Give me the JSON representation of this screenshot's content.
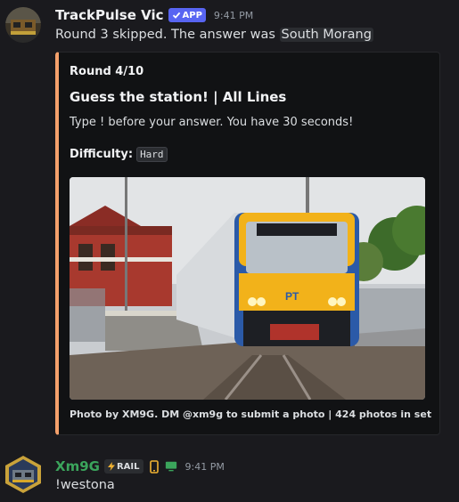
{
  "bot_message": {
    "username": "TrackPulse Vic",
    "badge": "APP",
    "time": "9:41 PM",
    "text_prefix": "Round 3 skipped. The answer was ",
    "answer": "South Morang"
  },
  "embed": {
    "accent_color": "#f4a06b",
    "round": "Round 4/10",
    "title": "Guess the station! | All Lines",
    "description": "Type ! before your answer. You have 30 seconds!",
    "difficulty_label": "Difficulty:",
    "difficulty_value": "Hard",
    "footer": "Photo by XM9G. DM @xm9g to submit a photo | 424 photos in set"
  },
  "user_message": {
    "username": "Xm9G",
    "badge": "RAIL",
    "time": "9:41 PM",
    "text": "!westona"
  },
  "icons": [
    "verified-check-icon",
    "lightning-icon",
    "mobile-icon",
    "desktop-icon"
  ]
}
